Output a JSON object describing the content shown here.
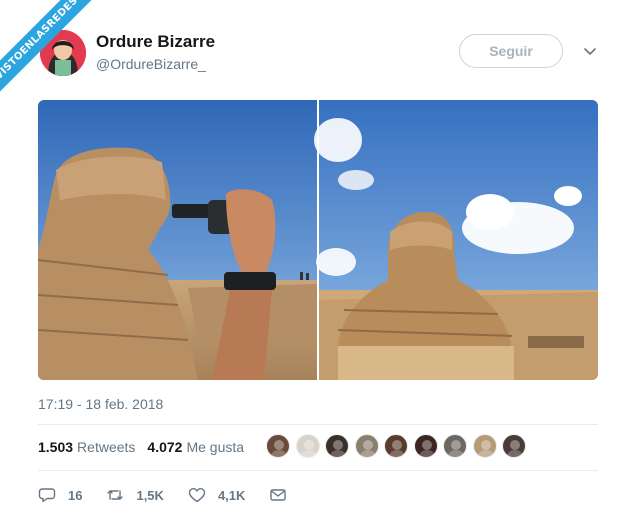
{
  "watermark": {
    "text": "VISTOENLASREDES"
  },
  "tweet": {
    "author_name": "Ordure Bizarre",
    "author_handle": "@OrdureBizarre_",
    "follow_label": "Seguir",
    "timestamp": "17:19 - 18 feb. 2018",
    "stats": {
      "retweets_count": "1.503",
      "retweets_label": "Retweets",
      "likes_count": "4.072",
      "likes_label": "Me gusta"
    },
    "actions": {
      "replies": "16",
      "retweets": "1,5K",
      "likes": "4,1K"
    },
    "liker_colors": [
      "#6b4a3a",
      "#d9d2c9",
      "#3b2f2a",
      "#8a7f6d",
      "#5a3b2c",
      "#3d2520",
      "#6e6660",
      "#b79a78",
      "#4b3a35"
    ]
  },
  "icons": {
    "reply": "reply-icon",
    "retweet": "retweet-icon",
    "like": "heart-icon",
    "dm": "envelope-icon",
    "more": "chevron-down-icon"
  },
  "colors": {
    "ribbon": "#2aa5e0",
    "avatar_bg": "#e23a4e",
    "secondary_text": "#657786"
  }
}
